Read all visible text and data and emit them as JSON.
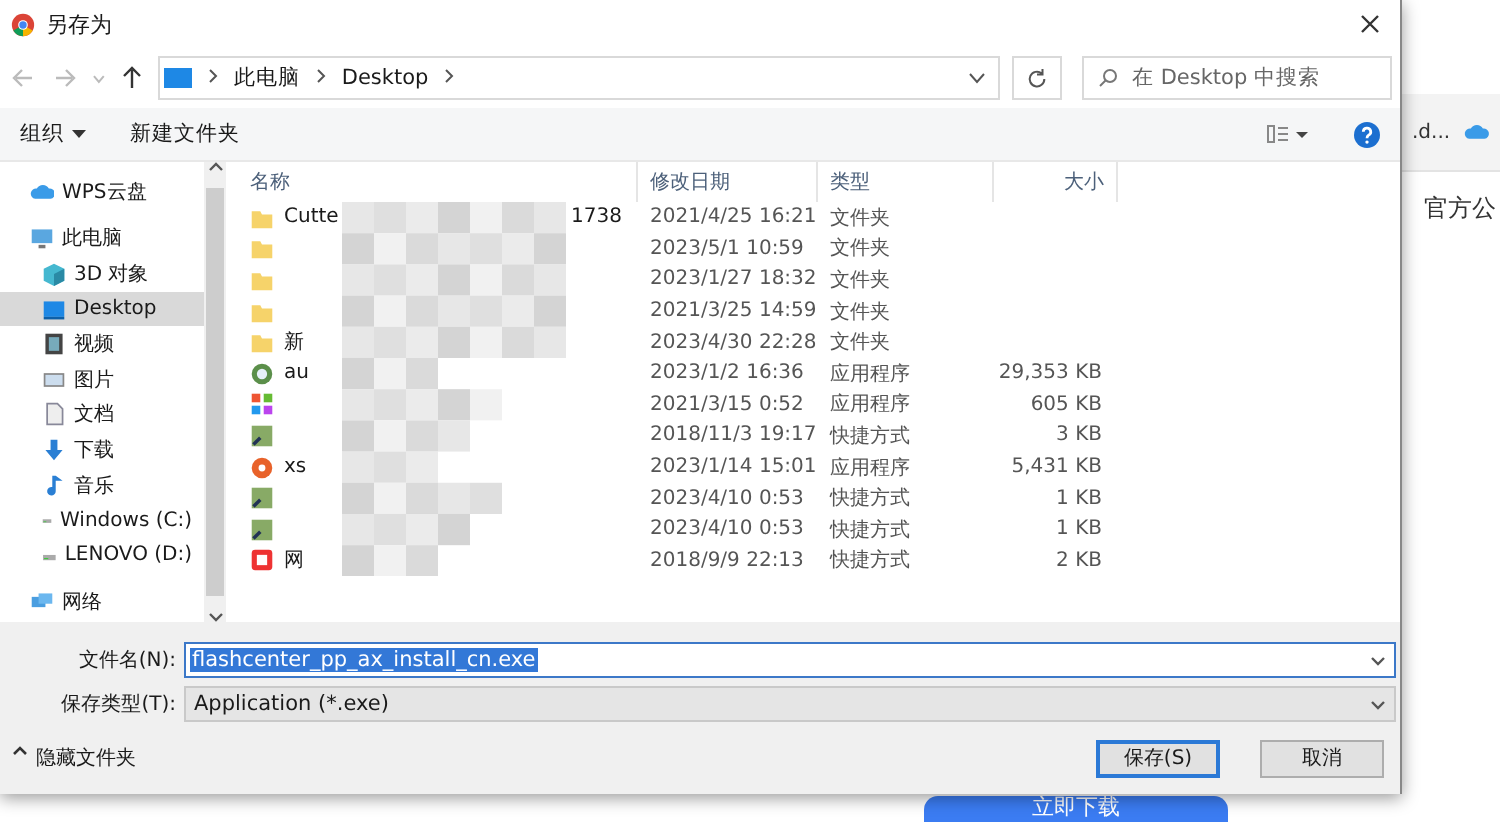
{
  "window": {
    "title": "另存为"
  },
  "address": {
    "crumbs": [
      "此电脑",
      "Desktop"
    ]
  },
  "search": {
    "placeholder": "在 Desktop 中搜索"
  },
  "toolbar": {
    "organize": "组织",
    "new_folder": "新建文件夹"
  },
  "sidebar": {
    "items": [
      {
        "label": "WPS云盘",
        "kind": "cloud",
        "selected": false
      },
      {
        "label": "此电脑",
        "kind": "pc",
        "selected": false,
        "children": [
          {
            "label": "3D 对象",
            "kind": "cube",
            "selected": false
          },
          {
            "label": "Desktop",
            "kind": "desktop",
            "selected": true
          },
          {
            "label": "视频",
            "kind": "video",
            "selected": false
          },
          {
            "label": "图片",
            "kind": "image",
            "selected": false
          },
          {
            "label": "文档",
            "kind": "doc",
            "selected": false
          },
          {
            "label": "下载",
            "kind": "download",
            "selected": false
          },
          {
            "label": "音乐",
            "kind": "music",
            "selected": false
          },
          {
            "label": "Windows (C:)",
            "kind": "drive",
            "selected": false
          },
          {
            "label": "LENOVO (D:)",
            "kind": "drive",
            "selected": false
          }
        ]
      },
      {
        "label": "网络",
        "kind": "network",
        "selected": false
      }
    ]
  },
  "table": {
    "columns": [
      "名称",
      "修改日期",
      "类型",
      "大小"
    ],
    "rows": [
      {
        "kind": "folder",
        "name": "Cutte",
        "name_end": "1738",
        "date": "2021/4/25 16:21",
        "type": "文件夹"
      },
      {
        "kind": "folder",
        "date": "2023/5/1 10:59",
        "type": "文件夹"
      },
      {
        "kind": "folder",
        "date": "2023/1/27 18:32",
        "type": "文件夹"
      },
      {
        "kind": "folder",
        "date": "2021/3/25 14:59",
        "type": "文件夹"
      },
      {
        "kind": "folder",
        "name": "新",
        "date": "2023/4/30 22:28",
        "type": "文件夹"
      },
      {
        "kind": "app",
        "name": "au",
        "date": "2023/1/2 16:36",
        "type": "应用程序",
        "size": "29,353 KB"
      },
      {
        "kind": "tiles",
        "date": "2021/3/15 0:52",
        "type": "应用程序",
        "size": "605 KB"
      },
      {
        "kind": "shortcut",
        "date": "2018/11/3 19:17",
        "type": "快捷方式",
        "size": "3 KB"
      },
      {
        "kind": "orange",
        "name": "xs",
        "date": "2023/1/14 15:01",
        "type": "应用程序",
        "size": "5,431 KB"
      },
      {
        "kind": "shortcut",
        "date": "2023/4/10 0:53",
        "type": "快捷方式",
        "size": "1 KB"
      },
      {
        "kind": "shortcut",
        "date": "2023/4/10 0:53",
        "type": "快捷方式",
        "size": "1 KB"
      },
      {
        "kind": "red",
        "name": "网",
        "date": "2018/9/9 22:13",
        "type": "快捷方式",
        "size": "2 KB"
      }
    ]
  },
  "form": {
    "filename_label": "文件名(N):",
    "filename": "flashcenter_pp_ax_install_cn.exe",
    "type_label": "保存类型(T):",
    "type_value": "Application (*.exe)"
  },
  "footer": {
    "hide_folders": "隐藏文件夹",
    "save": "保存(S)",
    "cancel": "取消"
  },
  "background": {
    "link": ".d...",
    "heading": "官方公",
    "download": "立即下载"
  }
}
